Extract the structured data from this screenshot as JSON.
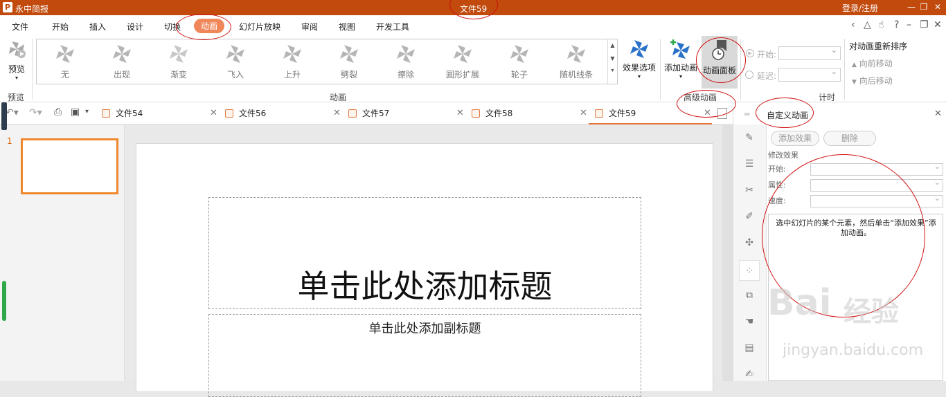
{
  "app": {
    "name": "永中简报",
    "document": "文件59",
    "login": "登录/注册"
  },
  "menu": [
    "文件",
    "开始",
    "插入",
    "设计",
    "切换",
    "动画",
    "幻灯片放映",
    "审阅",
    "视图",
    "开发工具"
  ],
  "active_menu": "动画",
  "ribbon": {
    "preview_label": "预览",
    "preview_group": "预览",
    "effects": [
      "无",
      "出现",
      "渐变",
      "飞入",
      "上升",
      "劈裂",
      "擦除",
      "圆形扩展",
      "轮子",
      "随机线条"
    ],
    "animation_group": "动画",
    "effect_options": "效果选项",
    "add_animation": "添加动画",
    "animation_pane": "动画面板",
    "advanced_group": "高级动画",
    "start_label": "开始:",
    "delay_label": "延迟:",
    "timing_group": "计时",
    "reorder_title": "对动画重新排序",
    "move_earlier": "向前移动",
    "move_later": "向后移动"
  },
  "tabs": [
    "文件54",
    "文件56",
    "文件57",
    "文件58",
    "文件59"
  ],
  "active_tab": "文件59",
  "slides": {
    "number": "1"
  },
  "slide": {
    "title": "单击此处添加标题",
    "subtitle": "单击此处添加副标题"
  },
  "panel": {
    "title": "自定义动画",
    "add_effect": "添加效果",
    "delete": "删除",
    "modify_effect": "修改效果",
    "start": "开始:",
    "property": "属性:",
    "speed": "速度:",
    "hint": "选中幻灯片的某个元素，然后单击“添加效果”添加动画。"
  },
  "watermark": {
    "brand": "Bai",
    "brand2": "经验",
    "url": "jingyan.baidu.com"
  },
  "colors": {
    "titlebar": "#c14a0c",
    "accent": "#f0875b",
    "annotation": "#d01010"
  },
  "icons": [
    "logo-icon",
    "preview-icon",
    "star-icon",
    "add-animation-icon",
    "animation-pane-icon",
    "clock-icon",
    "pencil-icon",
    "sliders-icon",
    "scissors-icon",
    "brush-icon",
    "windmill-icon",
    "grid-icon"
  ]
}
